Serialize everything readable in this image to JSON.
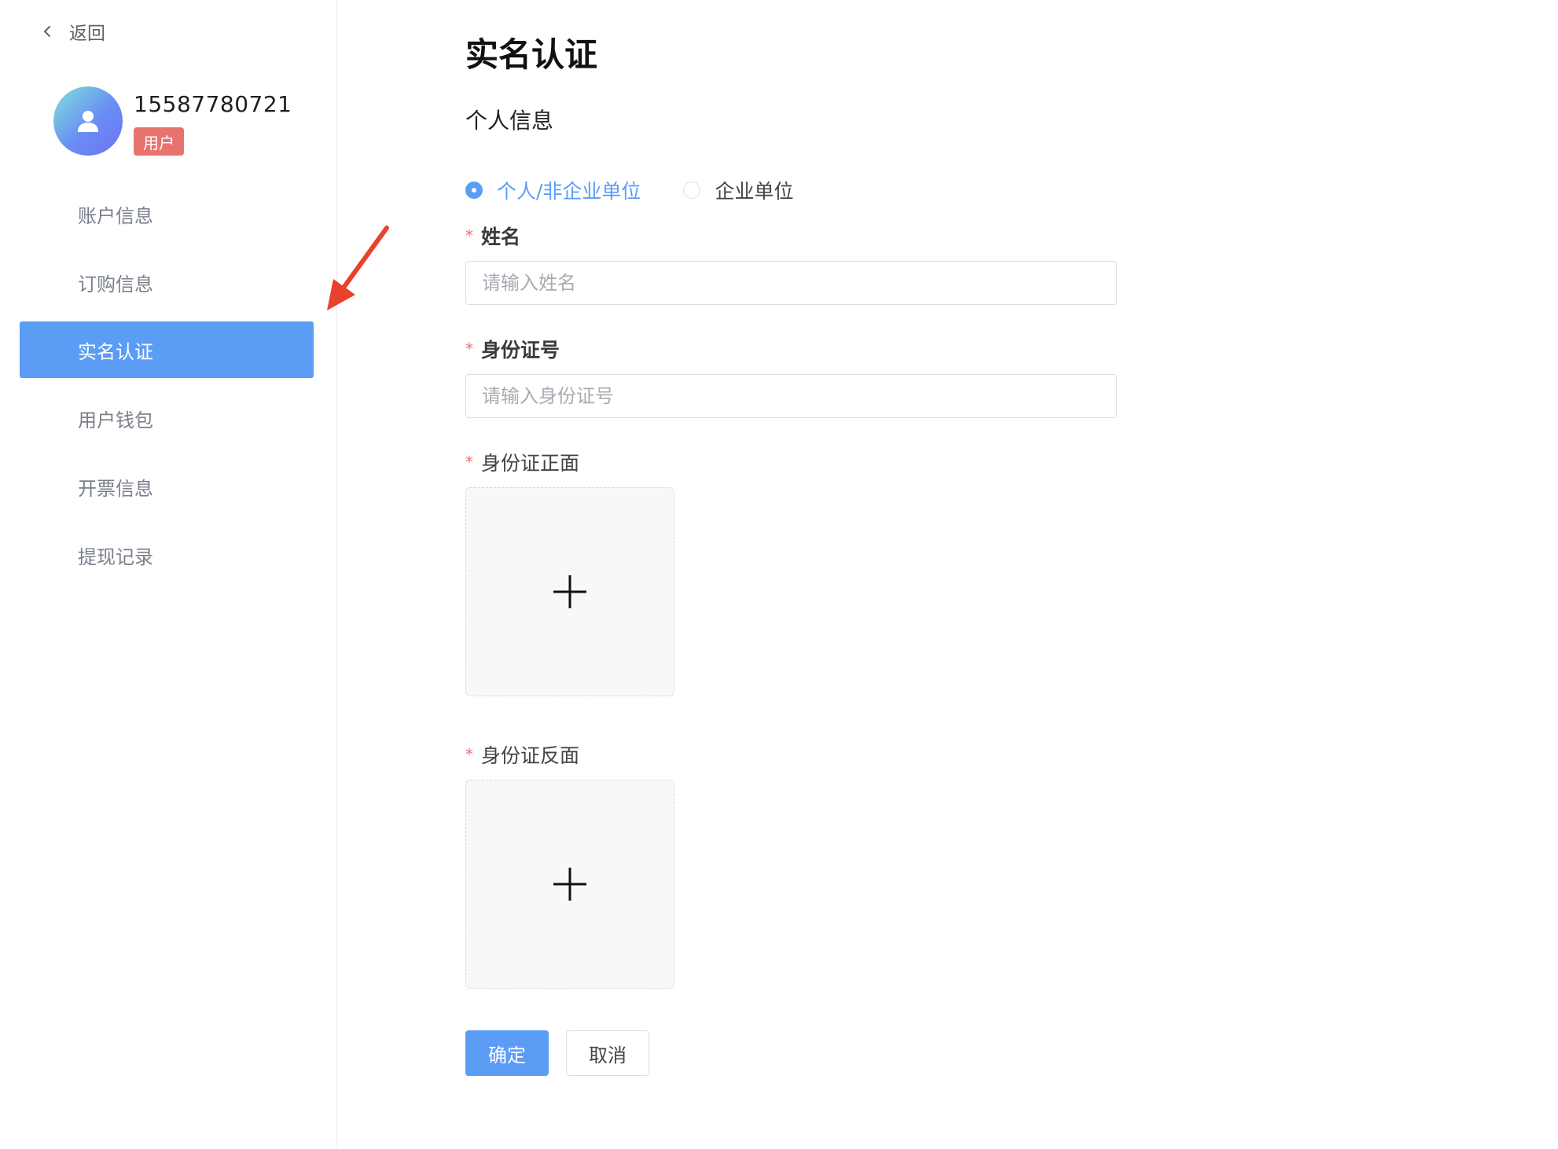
{
  "sidebar": {
    "back_label": "返回",
    "user": {
      "phone": "15587780721",
      "role": "用户"
    },
    "menu": [
      {
        "label": "账户信息",
        "active": false
      },
      {
        "label": "订购信息",
        "active": false
      },
      {
        "label": "实名认证",
        "active": true
      },
      {
        "label": "用户钱包",
        "active": false
      },
      {
        "label": "开票信息",
        "active": false
      },
      {
        "label": "提现记录",
        "active": false
      }
    ]
  },
  "main": {
    "title": "实名认证",
    "section_title": "个人信息",
    "entity_type": {
      "options": [
        "个人/非企业单位",
        "企业单位"
      ],
      "selected": "个人/非企业单位"
    },
    "fields": {
      "name": {
        "label": "姓名",
        "placeholder": "请输入姓名",
        "value": ""
      },
      "id_number": {
        "label": "身份证号",
        "placeholder": "请输入身份证号",
        "value": ""
      },
      "id_front": {
        "label": "身份证正面"
      },
      "id_back": {
        "label": "身份证反面"
      }
    },
    "actions": {
      "confirm": "确定",
      "cancel": "取消"
    }
  },
  "colors": {
    "accent": "#5b9cf5",
    "badge": "#e8726e",
    "required_mark": "#f56c6c",
    "annotation_arrow": "#e8412c"
  }
}
